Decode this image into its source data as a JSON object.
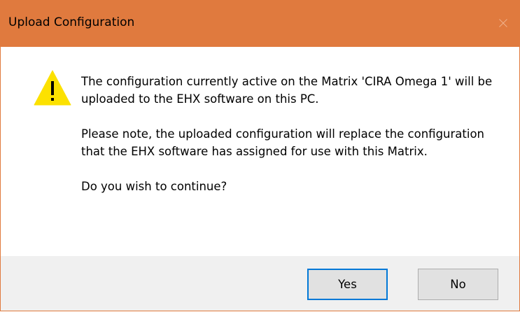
{
  "window": {
    "title": "Upload Configuration",
    "close_icon": "close-icon",
    "title_bar_color": "#e07a3e"
  },
  "message": {
    "icon": "warning-icon",
    "paragraph1": "The configuration currently active on the Matrix 'CIRA Omega 1' will be uploaded to the EHX software on this PC.",
    "paragraph2": "Please note, the uploaded configuration will replace the configuration that the EHX software has assigned for use with this Matrix.",
    "question": "Do you wish to continue?"
  },
  "buttons": {
    "yes_label": "Yes",
    "no_label": "No",
    "default_border_color": "#0078d7"
  }
}
